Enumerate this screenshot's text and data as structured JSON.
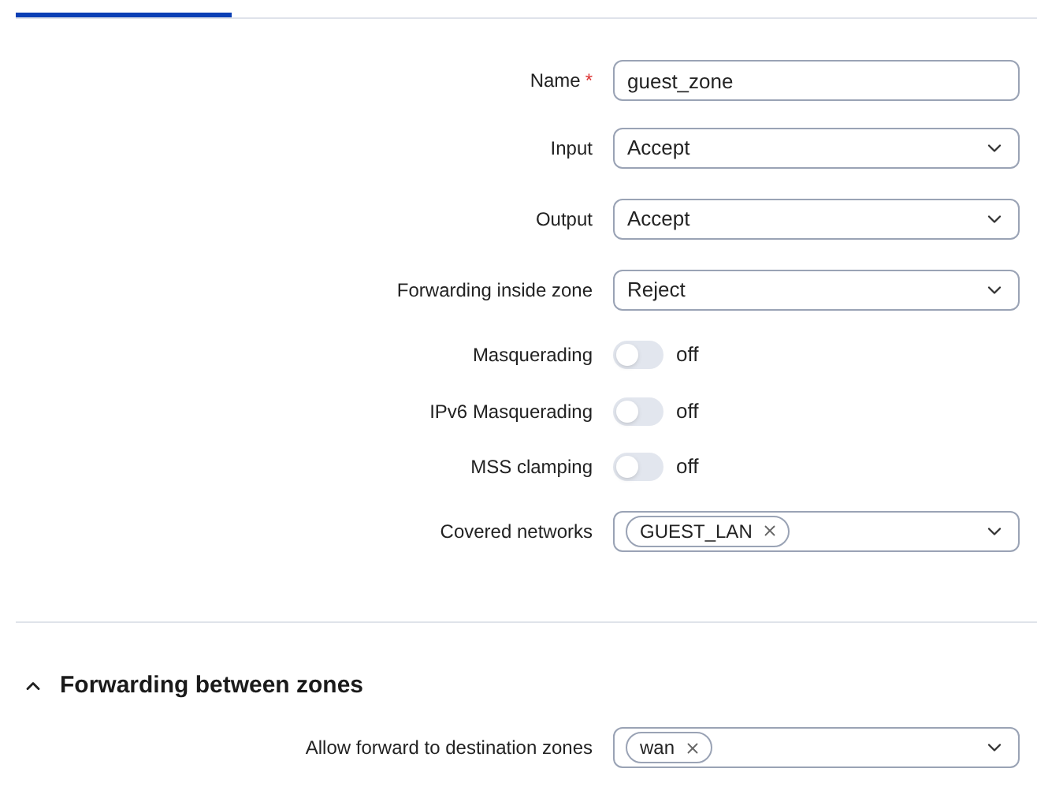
{
  "tabs": [
    {
      "selected": true
    }
  ],
  "fields": [
    {
      "kind": "text",
      "label": "Name",
      "required_mark": "*",
      "value": "guest_zone"
    },
    {
      "kind": "select",
      "label": "Input",
      "value": "Accept"
    },
    {
      "kind": "select",
      "label": "Output",
      "value": "Accept"
    },
    {
      "kind": "select",
      "label": "Forwarding inside zone",
      "value": "Reject"
    },
    {
      "kind": "toggle",
      "label": "Masquerading",
      "on": false,
      "state_text": "off"
    },
    {
      "kind": "toggle",
      "label": "IPv6 Masquerading",
      "on": false,
      "state_text": "off"
    },
    {
      "kind": "toggle",
      "label": "MSS clamping",
      "on": false,
      "state_text": "off"
    },
    {
      "kind": "multiselect",
      "label": "Covered networks",
      "tags": [
        "GUEST_LAN"
      ]
    }
  ],
  "section": {
    "title": "Forwarding between zones",
    "expanded": true,
    "fields": [
      {
        "kind": "multiselect",
        "label": "Allow forward to destination zones",
        "tags": [
          "wan"
        ]
      }
    ]
  }
}
